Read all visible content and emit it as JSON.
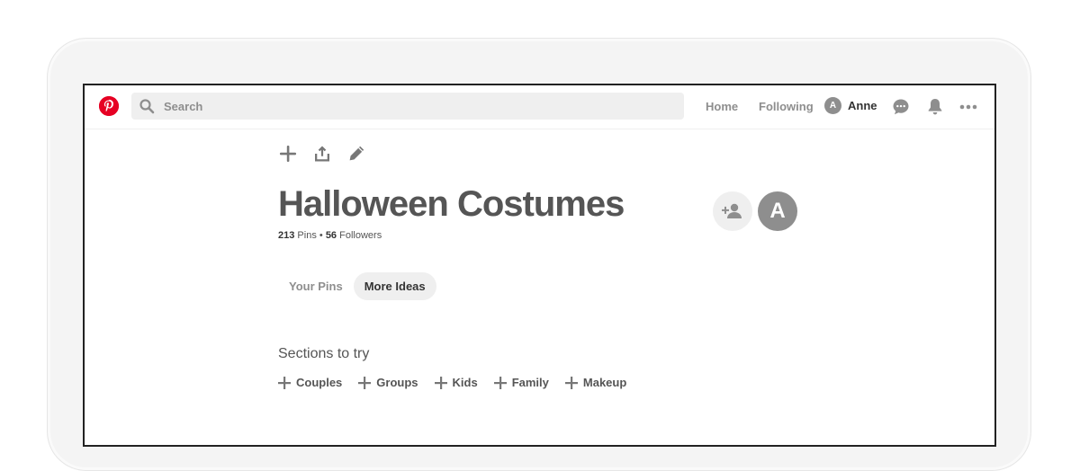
{
  "header": {
    "search": {
      "placeholder": "Search",
      "value": ""
    },
    "nav": {
      "home": "Home",
      "following": "Following"
    },
    "user": {
      "initial": "A",
      "name": "Anne"
    },
    "icons": [
      "pinterest-logo-icon",
      "search-icon",
      "chat-icon",
      "bell-icon",
      "more-icon"
    ]
  },
  "board": {
    "title": "Halloween Costumes",
    "pins_count": "213",
    "pins_label": "Pins",
    "separator": "•",
    "followers_count": "56",
    "followers_label": "Followers",
    "owner_initial": "A",
    "tools": [
      "add-icon",
      "share-icon",
      "edit-icon"
    ]
  },
  "tabs": [
    {
      "label": "Your Pins",
      "active": false
    },
    {
      "label": "More Ideas",
      "active": true
    }
  ],
  "sections": {
    "title": "Sections to try",
    "items": [
      "Couples",
      "Groups",
      "Kids",
      "Family",
      "Makeup"
    ]
  },
  "colors": {
    "brand": "#e60023",
    "muted": "#8e8e8e",
    "chip_bg": "#efefef",
    "title_text": "#555555"
  }
}
